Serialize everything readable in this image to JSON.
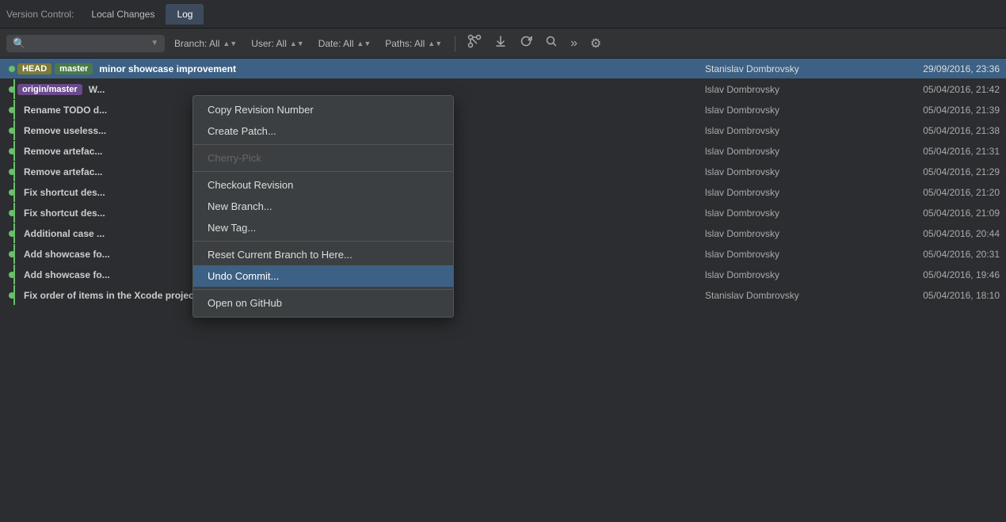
{
  "tabBar": {
    "versionControlLabel": "Version Control:",
    "tabs": [
      {
        "label": "Local Changes",
        "active": false
      },
      {
        "label": "Log",
        "active": true
      }
    ]
  },
  "toolbar": {
    "searchPlaceholder": "",
    "filters": [
      {
        "label": "Branch: All",
        "id": "branch-filter"
      },
      {
        "label": "User: All",
        "id": "user-filter"
      },
      {
        "label": "Date: All",
        "id": "date-filter"
      },
      {
        "label": "Paths: All",
        "id": "paths-filter"
      }
    ],
    "icons": [
      "merge-icon",
      "pull-icon",
      "refresh-icon",
      "find-icon",
      "more-icon",
      "settings-icon"
    ]
  },
  "commits": [
    {
      "tags": [
        {
          "label": "HEAD",
          "type": "head"
        },
        {
          "label": "master",
          "type": "master"
        }
      ],
      "message": "minor showcase improvement",
      "author": "Stanislav Dombrovsky",
      "date": "29/09/2016, 23:36",
      "selected": true
    },
    {
      "tags": [
        {
          "label": "origin/master",
          "type": "origin"
        }
      ],
      "message": "W...",
      "author": "lslav Dombrovsky",
      "date": "05/04/2016, 21:42",
      "selected": false
    },
    {
      "tags": [],
      "message": "Rename TODO d...",
      "author": "lslav Dombrovsky",
      "date": "05/04/2016, 21:39",
      "selected": false
    },
    {
      "tags": [],
      "message": "Remove useless...",
      "author": "lslav Dombrovsky",
      "date": "05/04/2016, 21:38",
      "selected": false
    },
    {
      "tags": [],
      "message": "Remove artefac...",
      "author": "lslav Dombrovsky",
      "date": "05/04/2016, 21:31",
      "selected": false
    },
    {
      "tags": [],
      "message": "Remove artefac...",
      "author": "lslav Dombrovsky",
      "date": "05/04/2016, 21:29",
      "selected": false
    },
    {
      "tags": [],
      "message": "Fix shortcut des...",
      "author": "lslav Dombrovsky",
      "date": "05/04/2016, 21:20",
      "selected": false
    },
    {
      "tags": [],
      "message": "Fix shortcut des...",
      "author": "lslav Dombrovsky",
      "date": "05/04/2016, 21:09",
      "selected": false
    },
    {
      "tags": [],
      "message": "Additional case ...",
      "author": "lslav Dombrovsky",
      "date": "05/04/2016, 20:44",
      "selected": false
    },
    {
      "tags": [],
      "message": "Add showcase fo...",
      "author": "lslav Dombrovsky",
      "date": "05/04/2016, 20:31",
      "selected": false
    },
    {
      "tags": [],
      "message": "Add showcase fo...",
      "author": "lslav Dombrovsky",
      "date": "05/04/2016, 19:46",
      "selected": false
    },
    {
      "tags": [],
      "message": "Fix order of items in the Xcode project.",
      "author": "Stanislav Dombrovsky",
      "date": "05/04/2016, 18:10",
      "selected": false
    }
  ],
  "contextMenu": {
    "items": [
      {
        "label": "Copy Revision Number",
        "type": "normal",
        "id": "copy-revision"
      },
      {
        "label": "Create Patch...",
        "type": "normal",
        "id": "create-patch"
      },
      {
        "type": "separator"
      },
      {
        "label": "Cherry-Pick",
        "type": "disabled",
        "id": "cherry-pick"
      },
      {
        "type": "separator"
      },
      {
        "label": "Checkout Revision",
        "type": "normal",
        "id": "checkout-revision"
      },
      {
        "label": "New Branch...",
        "type": "normal",
        "id": "new-branch"
      },
      {
        "label": "New Tag...",
        "type": "normal",
        "id": "new-tag"
      },
      {
        "type": "separator"
      },
      {
        "label": "Reset Current Branch to Here...",
        "type": "normal",
        "id": "reset-branch"
      },
      {
        "label": "Undo Commit...",
        "type": "highlighted",
        "id": "undo-commit"
      },
      {
        "type": "separator"
      },
      {
        "label": "Open on GitHub",
        "type": "normal",
        "id": "open-github"
      }
    ]
  }
}
